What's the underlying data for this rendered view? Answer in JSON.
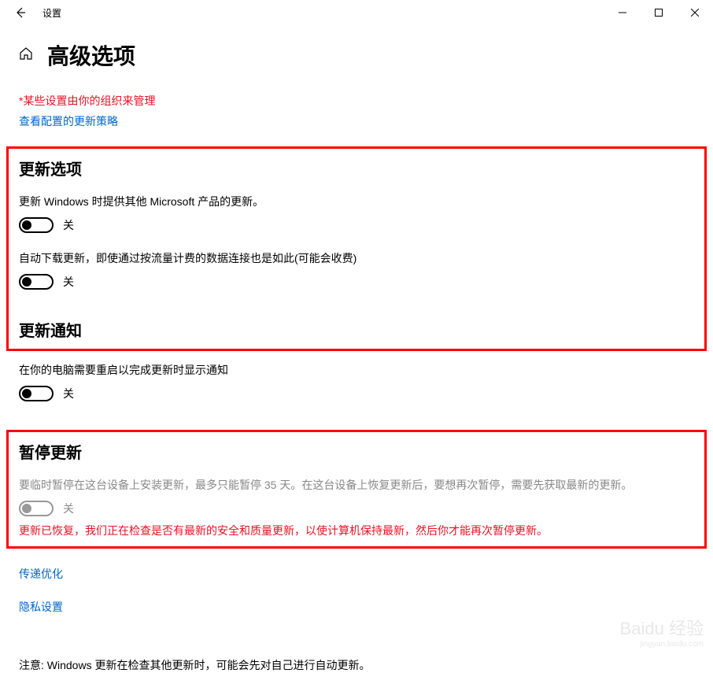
{
  "window": {
    "title": "设置"
  },
  "page": {
    "title": "高级选项",
    "org_warning": "*某些设置由你的组织来管理",
    "policy_link": "查看配置的更新策略"
  },
  "sections": {
    "update_options": {
      "title": "更新选项",
      "opt1_label": "更新 Windows 时提供其他 Microsoft 产品的更新。",
      "opt1_state": "关",
      "opt2_label": "自动下载更新，即使通过按流量计费的数据连接也是如此(可能会收费)",
      "opt2_state": "关"
    },
    "update_notify": {
      "title": "更新通知",
      "opt1_label": "在你的电脑需要重启以完成更新时显示通知",
      "opt1_state": "关"
    },
    "pause": {
      "title": "暂停更新",
      "desc": "要临时暂停在这台设备上安装更新，最多只能暂停 35 天。在这台设备上恢复更新后，要想再次暂停，需要先获取最新的更新。",
      "state": "关",
      "warning": "更新已恢复，我们正在检查是否有最新的安全和质量更新，以使计算机保持最新，然后你才能再次暂停更新。"
    }
  },
  "links": {
    "delivery": "传递优化",
    "privacy": "隐私设置"
  },
  "footer": {
    "note": "注意: Windows 更新在检查其他更新时，可能会先对自己进行自动更新。"
  },
  "watermark": {
    "main": "Baidu 经验",
    "sub": "jingyan.baidu.com"
  }
}
